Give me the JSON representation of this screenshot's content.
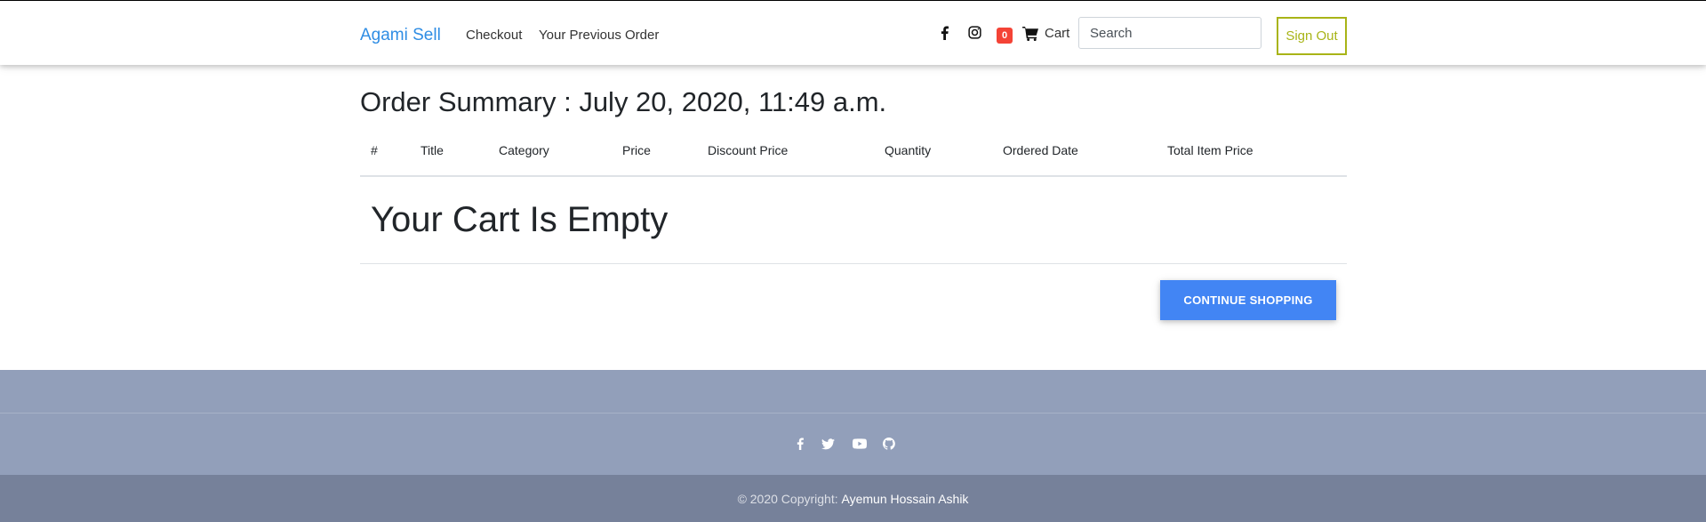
{
  "navbar": {
    "brand": "Agami Sell",
    "links": [
      "Checkout",
      "Your Previous Order"
    ],
    "icons": [
      "facebook-icon",
      "instagram-icon",
      "cart-icon"
    ],
    "cart_count": "0",
    "cart_label": "Cart",
    "search_placeholder": "Search",
    "sign_out": "Sign Out"
  },
  "main": {
    "title": "Order Summary : July 20, 2020, 11:49 a.m.",
    "columns": [
      "#",
      "Title",
      "Category",
      "Price",
      "Discount Price",
      "Quantity",
      "Ordered Date",
      "Total Item Price"
    ],
    "empty_message": "Your Cart Is Empty",
    "continue_button": "CONTINUE SHOPPING"
  },
  "footer": {
    "social_icons": [
      "facebook-icon",
      "twitter-icon",
      "youtube-icon",
      "github-icon"
    ],
    "copyright_text": "© 2020 Copyright: ",
    "author": "Ayemun Hossain Ashik"
  },
  "colors": {
    "brand": "#2f8de4",
    "badge": "#f44336",
    "sign_out": "#a8b417",
    "primary_button": "#4285f4",
    "footer": "#929fba",
    "copyright_bar": "#76819a"
  }
}
